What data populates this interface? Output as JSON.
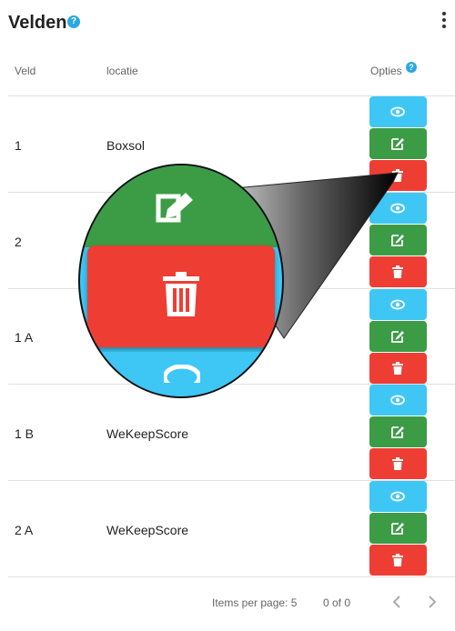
{
  "header": {
    "title": "Velden",
    "help_icon": "question-circle-icon",
    "menu_icon": "more-vertical-icon"
  },
  "table": {
    "columns": {
      "veld": "Veld",
      "locatie": "locatie",
      "opties": "Opties"
    },
    "rows": [
      {
        "veld": "1",
        "locatie": "Boxsol"
      },
      {
        "veld": "2",
        "locatie": ""
      },
      {
        "veld": "1 A",
        "locatie": ""
      },
      {
        "veld": "1 B",
        "locatie": "WeKeepScore"
      },
      {
        "veld": "2 A",
        "locatie": "WeKeepScore"
      }
    ],
    "actions": [
      {
        "name": "view",
        "icon": "eye-icon",
        "color": "#3ec7f5"
      },
      {
        "name": "edit",
        "icon": "edit-icon",
        "color": "#3c9c45"
      },
      {
        "name": "delete",
        "icon": "trash-icon",
        "color": "#ee3e34"
      }
    ]
  },
  "footer": {
    "items_per_page": "Items per page: 5",
    "range": "0 of 0",
    "prev_icon": "chevron-left-icon",
    "next_icon": "chevron-right-icon"
  },
  "callout": {
    "magnified_icon": "trash-icon"
  }
}
